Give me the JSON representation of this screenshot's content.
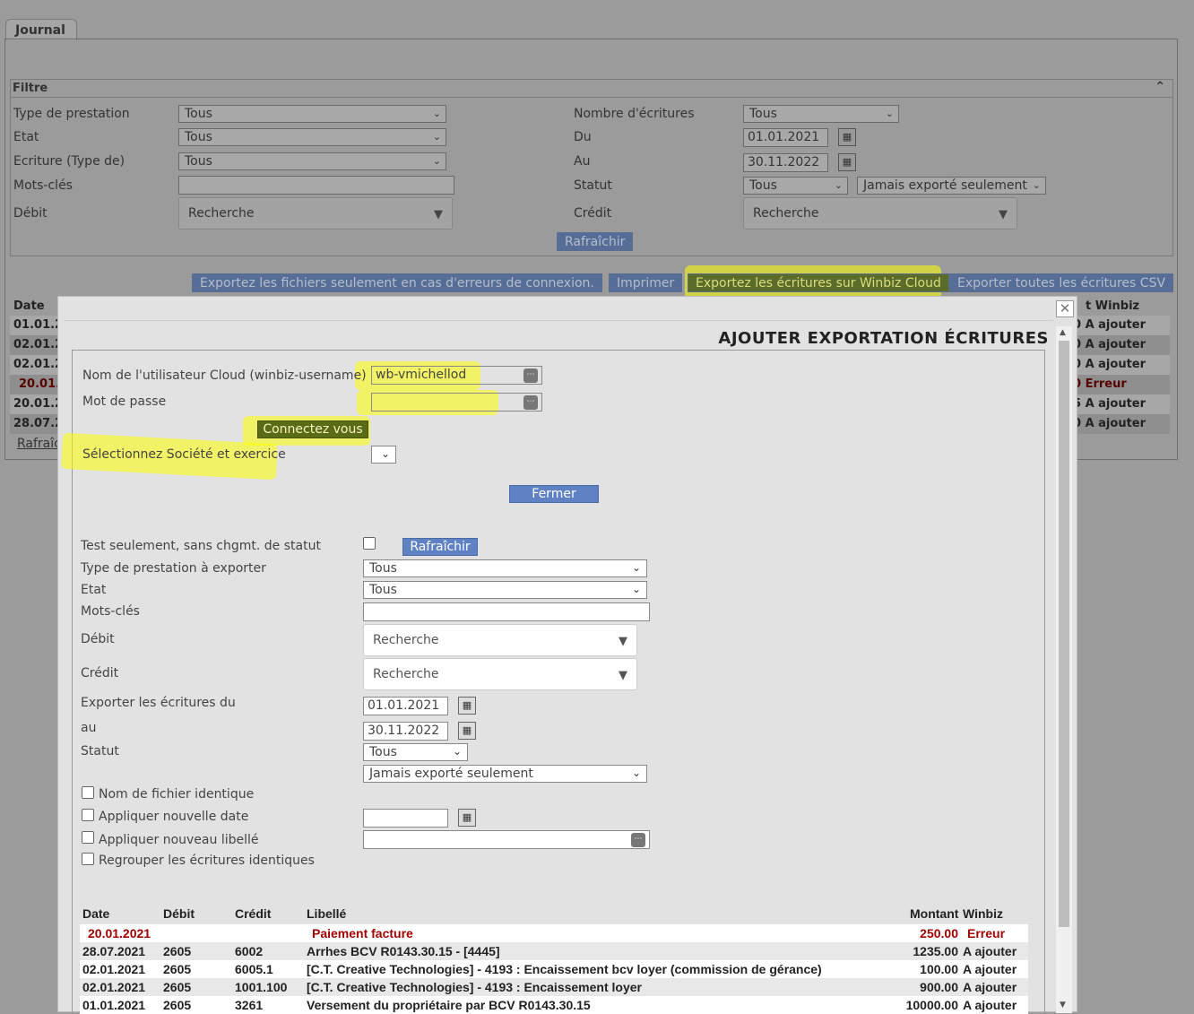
{
  "tab": {
    "label": "Journal"
  },
  "filter": {
    "title": "Filtre",
    "type_prestation": {
      "label": "Type de prestation",
      "value": "Tous"
    },
    "etat": {
      "label": "Etat",
      "value": "Tous"
    },
    "ecriture_type": {
      "label": "Ecriture (Type de)",
      "value": "Tous"
    },
    "mots_cles": {
      "label": "Mots-clés",
      "value": ""
    },
    "debit": {
      "label": "Débit",
      "value": "Recherche"
    },
    "nombre_ecritures": {
      "label": "Nombre d'écritures",
      "value": "Tous"
    },
    "du": {
      "label": "Du",
      "value": "01.01.2021"
    },
    "au": {
      "label": "Au",
      "value": "30.11.2022"
    },
    "statut": {
      "label": "Statut",
      "value": "Tous",
      "value2": "Jamais exporté seulement"
    },
    "credit": {
      "label": "Crédit",
      "value": "Recherche"
    },
    "refresh_label": "Rafraîchir"
  },
  "toolbar": {
    "export_errors": "Exportez les fichiers seulement en cas d'erreurs de connexion.",
    "print": "Imprimer",
    "export_winbiz": "Exportez les écritures sur Winbiz Cloud",
    "export_csv": "Exporter toutes les écritures CSV"
  },
  "bg_table": {
    "header_date": "Date",
    "header_winbiz": "t Winbiz",
    "rows": [
      {
        "date": "01.01.20",
        "tail": "0 A ajouter"
      },
      {
        "date": "02.01.20",
        "tail": "0 A ajouter"
      },
      {
        "date": "02.01.20",
        "tail": "0 A ajouter"
      },
      {
        "date": "20.01.",
        "tail": "0 Erreur"
      },
      {
        "date": "20.01.20",
        "tail": "5 A ajouter"
      },
      {
        "date": "28.07.20",
        "tail": "0 A ajouter"
      }
    ],
    "refresh_link": "Rafraîc"
  },
  "modal": {
    "title": "AJOUTER EXPORTATION ÉCRITURES",
    "username_label": "Nom de l'utilisateur Cloud (winbiz-username)",
    "username_value": "wb-vmichellod",
    "password_label": "Mot de passe",
    "connect_label": "Connectez vous",
    "company_label": "Sélectionnez Société et exercice",
    "close_label": "Fermer",
    "test_label": "Test seulement, sans chgmt. de statut",
    "refresh_label": "Rafraîchir",
    "type_prestation_label": "Type de prestation à exporter",
    "type_prestation_value": "Tous",
    "etat_label": "Etat",
    "etat_value": "Tous",
    "mots_cles_label": "Mots-clés",
    "debit_label": "Débit",
    "debit_value": "Recherche",
    "credit_label": "Crédit",
    "credit_value": "Recherche",
    "export_du_label": "Exporter les écritures du",
    "export_du_value": "01.01.2021",
    "au_label": "au",
    "au_value": "30.11.2022",
    "statut_label": "Statut",
    "statut_value": "Tous",
    "statut_value2": "Jamais exporté seulement",
    "nom_fichier_label": "Nom de fichier identique",
    "nouvelle_date_label": "Appliquer nouvelle date",
    "nouveau_libelle_label": "Appliquer nouveau libellé",
    "regrouper_label": "Regrouper les écritures identiques",
    "table": {
      "headers": {
        "date": "Date",
        "debit": "Débit",
        "credit": "Crédit",
        "libelle": "Libellé",
        "montant": "Montant",
        "winbiz": "Winbiz"
      },
      "rows": [
        {
          "date": "20.01.2021",
          "debit": "",
          "credit": "",
          "libelle": "Paiement facture",
          "montant": "250.00",
          "winbiz": "Erreur",
          "error": true
        },
        {
          "date": "28.07.2021",
          "debit": "2605",
          "credit": "6002",
          "libelle": "Arrhes BCV R0143.30.15 - [4445]",
          "montant": "1235.00",
          "winbiz": "A ajouter"
        },
        {
          "date": "02.01.2021",
          "debit": "2605",
          "credit": "6005.1",
          "libelle": "[C.T. Creative Technologies] - 4193 : Encaissement bcv loyer (commission de gérance)",
          "montant": "100.00",
          "winbiz": "A ajouter"
        },
        {
          "date": "02.01.2021",
          "debit": "2605",
          "credit": "1001.100",
          "libelle": "[C.T. Creative Technologies] - 4193 : Encaissement loyer",
          "montant": "900.00",
          "winbiz": "A ajouter"
        },
        {
          "date": "01.01.2021",
          "debit": "2605",
          "credit": "3261",
          "libelle": "Versement du propriétaire par BCV R0143.30.15",
          "montant": "10000.00",
          "winbiz": "A ajouter"
        }
      ]
    }
  },
  "colors": {
    "highlight": "#ffff00",
    "button_blue": "#5f82c4",
    "error_red": "#a00000"
  }
}
